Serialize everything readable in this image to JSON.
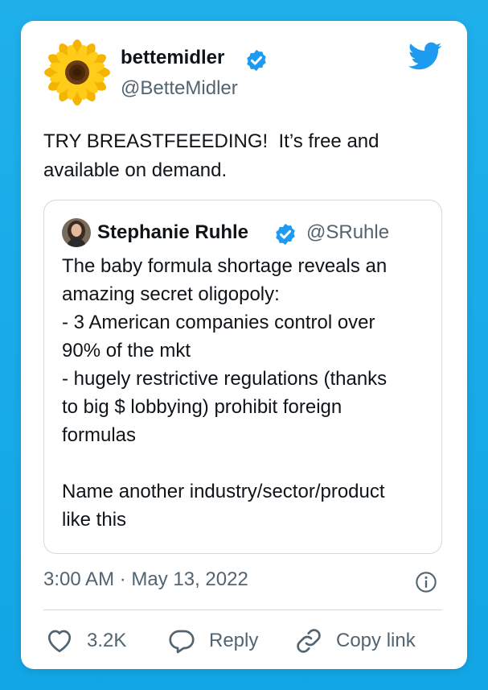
{
  "tweet": {
    "author_name": "bettemidler",
    "author_handle": "@BetteMidler",
    "text": "TRY BREASTFEEEDING!  It’s free and\navailable on demand.",
    "timestamp": "3:00 AM · May 13, 2022"
  },
  "quoted_tweet": {
    "author_name": "Stephanie Ruhle",
    "author_handle": "@SRuhle",
    "text": "The baby formula shortage reveals an\namazing secret oligopoly:\n- 3 American companies control over\n90% of the mkt\n- hugely restrictive regulations (thanks\nto big $ lobbying) prohibit foreign\nformulas\n\nName another industry/sector/product\nlike this"
  },
  "actions": {
    "like_count": "3.2K",
    "reply_label": "Reply",
    "copy_link_label": "Copy link"
  },
  "icons": {
    "avatar": "sunflower-avatar",
    "verified": "verified-badge-icon",
    "brand": "twitter-bird-icon",
    "info": "info-icon",
    "like": "heart-icon",
    "reply": "reply-bubble-icon",
    "copy": "link-icon"
  },
  "colors": {
    "background": "#1da1f2",
    "accent": "#1d9bf0",
    "text_primary": "#0f1419",
    "text_secondary": "#536471",
    "border": "#cfd9de"
  }
}
